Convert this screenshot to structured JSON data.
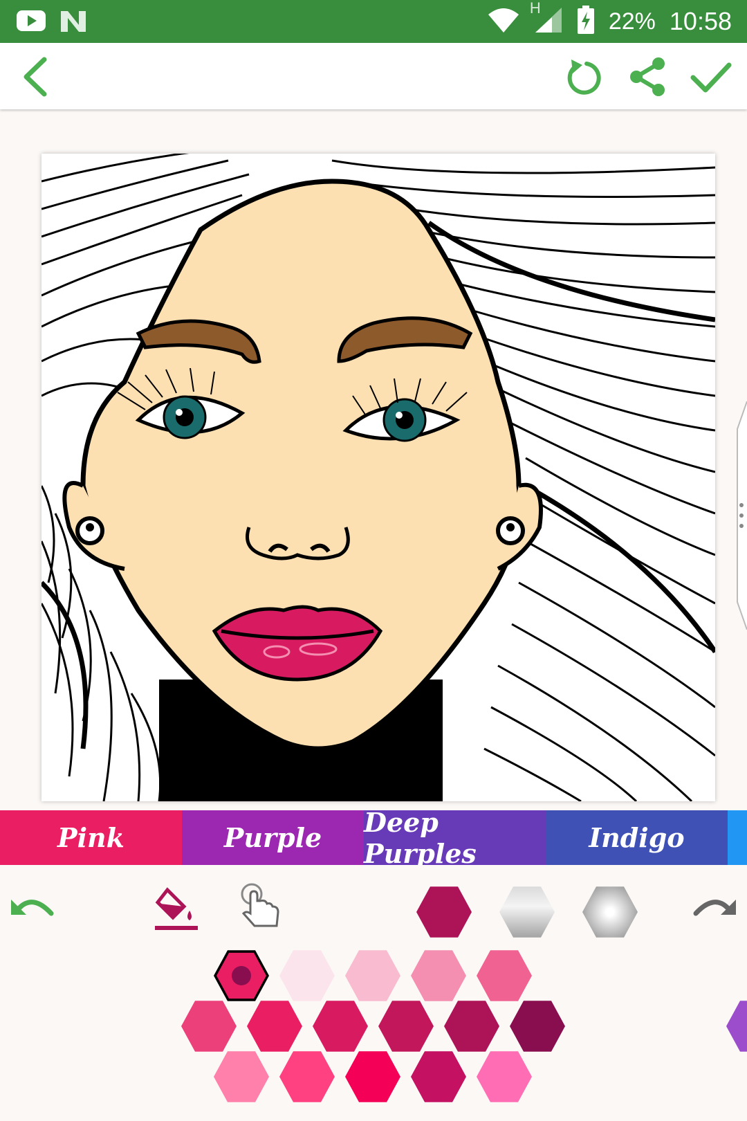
{
  "status_bar": {
    "battery": "22%",
    "time": "10:58",
    "network_label": "H"
  },
  "toolbar": {
    "back_icon": "back-arrow-icon",
    "reset_icon": "reset-icon",
    "share_icon": "share-icon",
    "done_icon": "check-icon"
  },
  "palette_tabs": [
    {
      "label": "Pink",
      "color": "#e91e63"
    },
    {
      "label": "Purple",
      "color": "#9c27b0"
    },
    {
      "label": "Deep Purples",
      "color": "#673ab7"
    },
    {
      "label": "Indigo",
      "color": "#3f51b5"
    },
    {
      "label": "",
      "color": "#2196f3"
    }
  ],
  "tools": {
    "undo_icon": "undo-icon",
    "fill_icon": "paint-bucket-icon",
    "fill_selected": true,
    "touch_icon": "touch-hand-icon",
    "redo_icon": "redo-icon",
    "current_color": "#ad1457",
    "gradient_swatches": [
      "silver-gradient",
      "white-gray-gradient"
    ]
  },
  "swatches": {
    "row1": [
      "#e91e63",
      "#fce4ec",
      "#f8bbd0",
      "#f48fb1",
      "#f06292"
    ],
    "row2": [
      "#ec407a",
      "#e91e63",
      "#d81b60",
      "#c2185b",
      "#ad1457",
      "#880e4f"
    ],
    "row3": [
      "#ff80ab",
      "#ff4081",
      "#f50057",
      "#c51162",
      "#ff6eb4"
    ],
    "selected": "#e91e63",
    "next_palette_peek": "#9c4dcc"
  },
  "colors": {
    "accent": "#4caf50",
    "skin": "#fde0b2",
    "lips": "#d81b60",
    "brows": "#8d5a2b",
    "iris": "#1a6b6b"
  }
}
